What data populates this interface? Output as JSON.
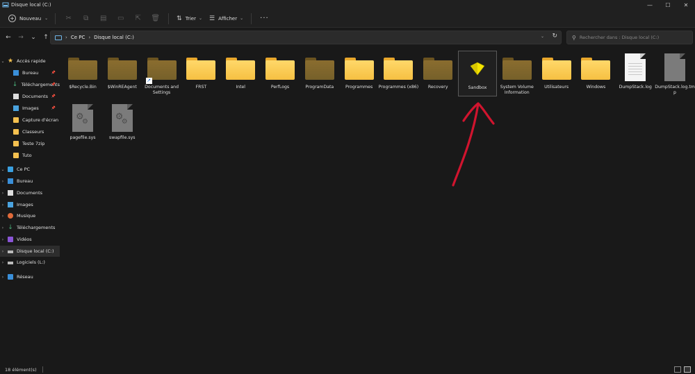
{
  "window": {
    "title": "Disque local (C:)",
    "controls": [
      "—",
      "☐",
      "✕"
    ]
  },
  "toolbar": {
    "new_label": "Nouveau",
    "sort_label": "Trier",
    "view_label": "Afficher",
    "more": "···"
  },
  "address": {
    "crumbs": [
      "Ce PC",
      "Disque local (C:)"
    ],
    "search_placeholder": "Rechercher dans : Disque local (C:)"
  },
  "sidebar": {
    "items": [
      {
        "label": "Accès rapide",
        "icon": "star-icon",
        "expand": "v",
        "pinned": false
      },
      {
        "label": "Bureau",
        "icon": "desktop-icon",
        "expand": "",
        "pinned": true
      },
      {
        "label": "Téléchargements",
        "icon": "download-icon",
        "expand": "",
        "pinned": true
      },
      {
        "label": "Documents",
        "icon": "document-icon",
        "expand": "",
        "pinned": true
      },
      {
        "label": "Images",
        "icon": "image-icon",
        "expand": "",
        "pinned": true
      },
      {
        "label": "Capture d'écran",
        "icon": "folder-icon",
        "expand": "",
        "pinned": false
      },
      {
        "label": "Classeurs",
        "icon": "folder-icon",
        "expand": "",
        "pinned": false
      },
      {
        "label": "Teste 7zip",
        "icon": "folder-icon",
        "expand": "",
        "pinned": false
      },
      {
        "label": "Tuto",
        "icon": "folder-icon",
        "expand": "",
        "pinned": false
      },
      {
        "label": "Ce PC",
        "icon": "pc-icon",
        "expand": "v",
        "pinned": false
      },
      {
        "label": "Bureau",
        "icon": "desktop-icon",
        "expand": ">",
        "pinned": false
      },
      {
        "label": "Documents",
        "icon": "document-icon",
        "expand": ">",
        "pinned": false
      },
      {
        "label": "Images",
        "icon": "image-icon",
        "expand": ">",
        "pinned": false
      },
      {
        "label": "Musique",
        "icon": "music-icon",
        "expand": ">",
        "pinned": false
      },
      {
        "label": "Téléchargements",
        "icon": "download-icon",
        "expand": ">",
        "pinned": false
      },
      {
        "label": "Vidéos",
        "icon": "video-icon",
        "expand": ">",
        "pinned": false
      },
      {
        "label": "Disque local (C:)",
        "icon": "drive-icon",
        "expand": ">",
        "pinned": false
      },
      {
        "label": "Logiciels (L:)",
        "icon": "drive-icon",
        "expand": ">",
        "pinned": false
      },
      {
        "label": "Réseau",
        "icon": "network-icon",
        "expand": ">",
        "pinned": false
      }
    ]
  },
  "files": [
    {
      "name": "$Recycle.Bin",
      "kind": "folder-dim"
    },
    {
      "name": "$WinREAgent",
      "kind": "folder-dim"
    },
    {
      "name": "Documents and Settings",
      "kind": "folder-shortcut"
    },
    {
      "name": "FRST",
      "kind": "folder"
    },
    {
      "name": "Intel",
      "kind": "folder"
    },
    {
      "name": "PerfLogs",
      "kind": "folder"
    },
    {
      "name": "ProgramData",
      "kind": "folder-dim"
    },
    {
      "name": "Programmes",
      "kind": "folder"
    },
    {
      "name": "Programmes (x86)",
      "kind": "folder"
    },
    {
      "name": "Recovery",
      "kind": "folder-dim"
    },
    {
      "name": "Sandbox",
      "kind": "sandbox"
    },
    {
      "name": "System Volume Information",
      "kind": "folder-dim"
    },
    {
      "name": "Utilisateurs",
      "kind": "folder"
    },
    {
      "name": "Windows",
      "kind": "folder"
    },
    {
      "name": "DumpStack.log",
      "kind": "text-file"
    },
    {
      "name": "DumpStack.log.tmp",
      "kind": "gray-file"
    },
    {
      "name": "pagefile.sys",
      "kind": "system-file"
    },
    {
      "name": "swapfile.sys",
      "kind": "system-file"
    }
  ],
  "status": {
    "count": "18 élément(s)"
  },
  "colors": {
    "annotation_arrow": "#d0142e",
    "folder": "#f6c042",
    "sandbox": "#f5e400"
  }
}
